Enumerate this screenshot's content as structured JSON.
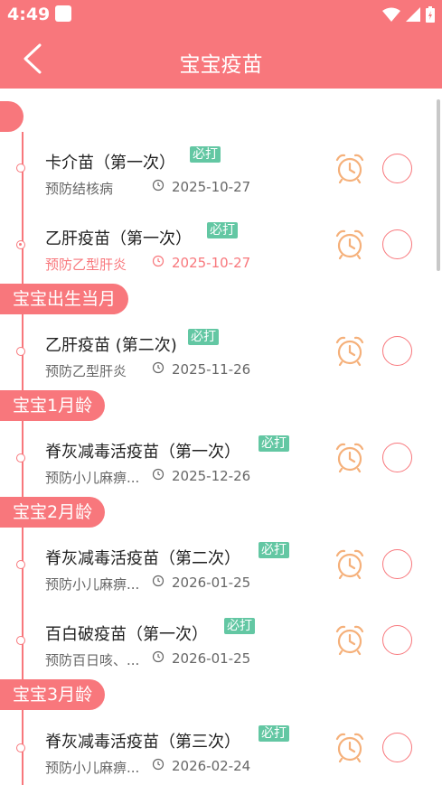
{
  "status": {
    "time": "4:49"
  },
  "header": {
    "title": "宝宝疫苗"
  },
  "groups": [
    {
      "label": "宝宝出生当月"
    },
    {
      "label": "宝宝1月龄"
    },
    {
      "label": "宝宝2月龄"
    },
    {
      "label": "宝宝3月龄"
    }
  ],
  "vaccines": [
    {
      "name": "卡介苗（第一次）",
      "badge": "必打",
      "desc": "预防结核病",
      "date": "2025-10-27"
    },
    {
      "name": "乙肝疫苗（第一次）",
      "badge": "必打",
      "desc": "预防乙型肝炎",
      "date": "2025-10-27"
    },
    {
      "name": "乙肝疫苗 (第二次)",
      "badge": "必打",
      "desc": "预防乙型肝炎",
      "date": "2025-11-26"
    },
    {
      "name": "脊灰减毒活疫苗（第一次）",
      "badge": "必打",
      "desc": "预防小儿麻痹...",
      "date": "2025-12-26"
    },
    {
      "name": "脊灰减毒活疫苗（第二次）",
      "badge": "必打",
      "desc": "预防小儿麻痹...",
      "date": "2026-01-25"
    },
    {
      "name": "百白破疫苗（第一次）",
      "badge": "必打",
      "desc": "预防百日咳、...",
      "date": "2026-01-25"
    },
    {
      "name": "脊灰减毒活疫苗（第三次）",
      "badge": "必打",
      "desc": "预防小儿麻痹...",
      "date": "2026-02-24"
    }
  ],
  "colors": {
    "accent": "#f8777c",
    "badge": "#63c7a3",
    "alarm": "#f5b07a"
  }
}
